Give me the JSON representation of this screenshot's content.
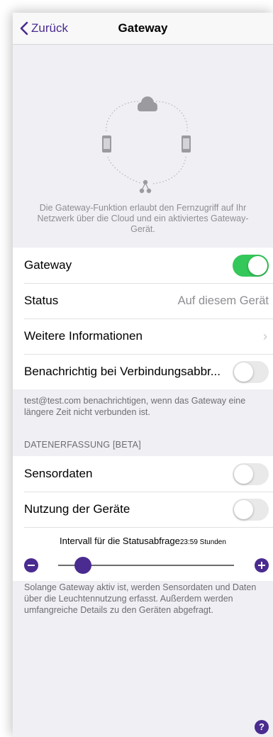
{
  "nav": {
    "back_label": "Zurück",
    "title": "Gateway"
  },
  "intro": {
    "description": "Die Gateway-Funktion erlaubt den Fernzugriff auf Ihr Netzwerk über die Cloud und ein aktiviertes Gateway-Gerät."
  },
  "settings": [
    {
      "label": "Gateway",
      "type": "toggle",
      "on": true
    },
    {
      "label": "Status",
      "type": "value",
      "value": "Auf diesem Gerät"
    },
    {
      "label": "Weitere Informationen",
      "type": "chevron"
    },
    {
      "label": "Benachrichtig bei Verbindungsabbr...",
      "type": "toggle",
      "on": false
    }
  ],
  "notify_footer": "test@test.com benachrichtigen, wenn das Gateway eine längere Zeit nicht verbunden ist.",
  "data_section": {
    "header": "DATENERFASSUNG [BETA]",
    "rows": [
      {
        "label": "Sensordaten",
        "on": false
      },
      {
        "label": "Nutzung der Geräte",
        "on": false
      }
    ],
    "interval": {
      "label": "Intervall für die Statusabfrage",
      "value": "23:59 Stunden",
      "position": 0.14
    }
  },
  "data_footer": "Solange Gateway aktiv ist, werden Sensordaten und Daten über die Leuchtennutzung erfasst. Außerdem werden umfangreiche Details zu den Geräten abgefragt.",
  "help_label": "?",
  "colors": {
    "accent": "#4a2b8f",
    "toggle_on": "#34c759"
  }
}
